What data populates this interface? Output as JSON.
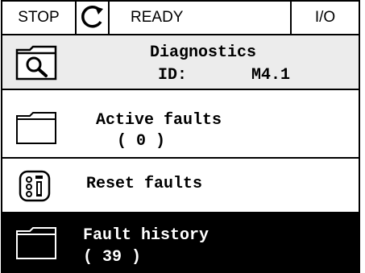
{
  "statusbar": {
    "stop_label": "STOP",
    "direction_icon": "rotation-arrow-icon",
    "ready_label": "READY",
    "io_label": "I/O"
  },
  "header": {
    "title": "Diagnostics",
    "id_label": "ID:",
    "id_value": "M4.1",
    "icon": "magnifier-icon"
  },
  "menu": {
    "items": [
      {
        "label": "Active faults",
        "count": "( 0 )",
        "icon": "folder-icon",
        "selected": false
      },
      {
        "label": "Reset faults",
        "icon": "reset-icon",
        "selected": false
      },
      {
        "label": "Fault history",
        "count": "( 39 )",
        "icon": "folder-icon",
        "selected": true
      }
    ]
  },
  "colors": {
    "selected_bg": "#000000",
    "selected_fg": "#ffffff",
    "header_bg": "#ececec"
  }
}
